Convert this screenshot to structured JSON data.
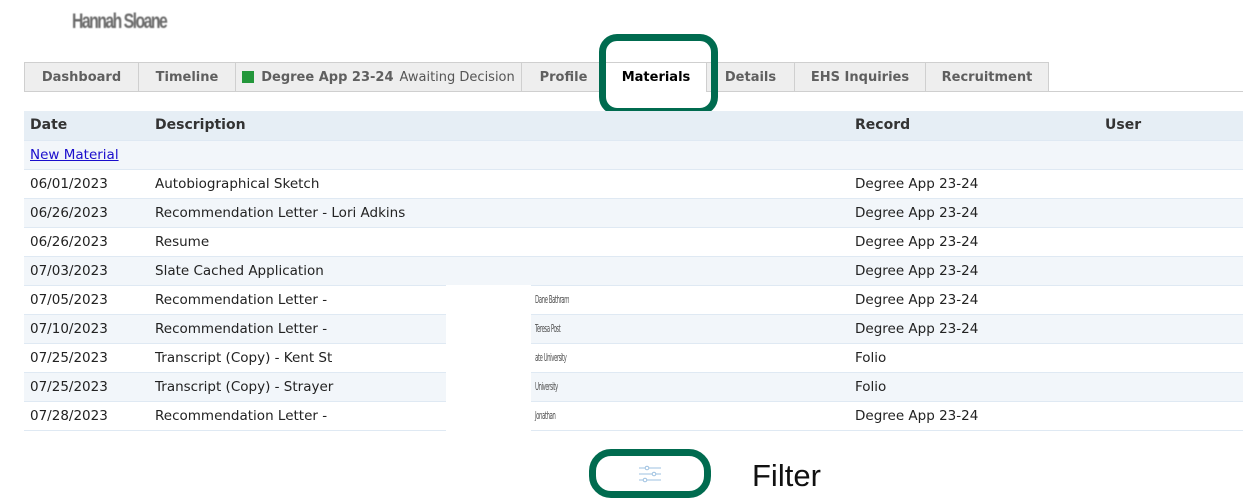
{
  "header": {
    "person_name": "Hannah Sloane"
  },
  "tabs": [
    {
      "label": "Dashboard"
    },
    {
      "label": "Timeline"
    },
    {
      "label": "Degree App 23-24",
      "status": "Awaiting Decision",
      "status_color": "#23973b"
    },
    {
      "label": "Profile"
    },
    {
      "label": "Materials",
      "active": true
    },
    {
      "label": "Details"
    },
    {
      "label": "EHS Inquiries"
    },
    {
      "label": "Recruitment"
    }
  ],
  "table": {
    "columns": [
      "Date",
      "Description",
      "Record",
      "User"
    ],
    "new_material_label": "New Material",
    "rows": [
      {
        "date": "06/01/2023",
        "description": "Autobiographical Sketch",
        "record": "Degree App 23-24",
        "user": ""
      },
      {
        "date": "06/26/2023",
        "description": "Recommendation Letter - Lori Adkins",
        "record": "Degree App 23-24",
        "user": ""
      },
      {
        "date": "06/26/2023",
        "description": "Resume",
        "record": "Degree App 23-24",
        "user": ""
      },
      {
        "date": "07/03/2023",
        "description": "Slate Cached Application",
        "record": "Degree App 23-24",
        "user": ""
      },
      {
        "date": "07/05/2023",
        "description": "Recommendation Letter -",
        "description_tail": "Dane Bathram",
        "record": "Degree App 23-24",
        "user": ""
      },
      {
        "date": "07/10/2023",
        "description": "Recommendation Letter -",
        "description_tail": "Teresa Post",
        "record": "Degree App 23-24",
        "user": ""
      },
      {
        "date": "07/25/2023",
        "description": "Transcript (Copy) - Kent St",
        "description_tail": "ate University",
        "record": "Folio",
        "user": ""
      },
      {
        "date": "07/25/2023",
        "description": "Transcript (Copy) - Strayer",
        "description_tail": "University",
        "record": "Folio",
        "user": ""
      },
      {
        "date": "07/28/2023",
        "description": "Recommendation Letter -",
        "description_tail": "Jonathan",
        "record": "Degree App 23-24",
        "user": ""
      }
    ]
  },
  "filter": {
    "label": "Filter",
    "icon": "sliders-icon"
  },
  "colors": {
    "highlight": "#006b4f",
    "link": "#1a0dcc",
    "header_bg": "#e6eef5"
  }
}
